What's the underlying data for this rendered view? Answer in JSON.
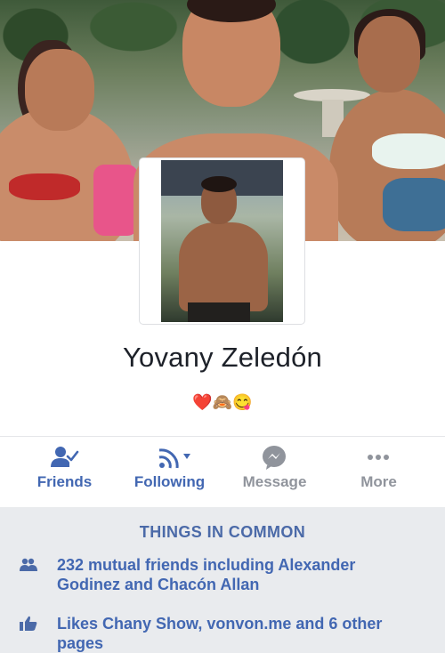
{
  "profile": {
    "name": "Yovany Zeledón",
    "bio": "❤️🙈😋"
  },
  "actions": [
    {
      "label": "Friends",
      "icon": "friends-check-icon",
      "active": true
    },
    {
      "label": "Following",
      "icon": "rss-feed-icon",
      "active": true
    },
    {
      "label": "Message",
      "icon": "messenger-icon",
      "active": false
    },
    {
      "label": "More",
      "icon": "more-dots-icon",
      "active": false
    }
  ],
  "common": {
    "title": "THINGS IN COMMON",
    "rows": [
      {
        "icon": "mutual-friends-icon",
        "text": "232 mutual friends including Alexander Godinez and Chacón Allan"
      },
      {
        "icon": "thumbs-up-icon",
        "text": "Likes Chany Show, vonvon.me and 6 other pages"
      }
    ]
  },
  "colors": {
    "accent": "#4267b2",
    "muted": "#90949c",
    "section_bg": "#e9ebee",
    "name": "#1d2129"
  }
}
